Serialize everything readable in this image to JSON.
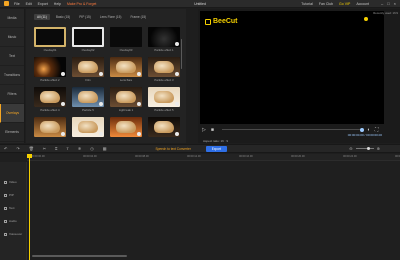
{
  "window": {
    "title": "Untitled",
    "menu": [
      "File",
      "Edit",
      "Export",
      "Help",
      "Make Pro & Forget"
    ],
    "menu_accent": "Make Pro & Forget",
    "right_menu": [
      "Tutorial",
      "Fan Club",
      "Go VIP",
      "Account"
    ]
  },
  "sidebar": {
    "items": [
      "Media",
      "Music",
      "Text",
      "Transitions",
      "Filters",
      "Overlays",
      "Elements"
    ],
    "active": "Overlays"
  },
  "media": {
    "tabs": [
      "All (11)",
      "Basic (15)",
      "PIP (15)",
      "Lens Flare (15)",
      "Frame (15)"
    ],
    "active_tab": "All (11)",
    "items": [
      {
        "caption": "Overlay01",
        "style": "frame-gold"
      },
      {
        "caption": "Overlay02",
        "style": "frame-rect"
      },
      {
        "caption": "Overlay03",
        "style": "frame-corners"
      },
      {
        "caption": "Particle effect 1",
        "style": "dark"
      },
      {
        "caption": "Particle effect 2",
        "style": "flare"
      },
      {
        "caption": "Film",
        "style": "cat"
      },
      {
        "caption": "Lens flare",
        "style": "cat-warm"
      },
      {
        "caption": "Particle effect 3",
        "style": "cat"
      },
      {
        "caption": "Particle effect 4",
        "style": "cat-dark"
      },
      {
        "caption": "Particle 5",
        "style": "cat-blue"
      },
      {
        "caption": "Light leak 1",
        "style": "cat"
      },
      {
        "caption": "Particle effect 5",
        "style": "cat-bright"
      },
      {
        "caption": "",
        "style": "cat-warm"
      },
      {
        "caption": "",
        "style": "cat-bright"
      },
      {
        "caption": "",
        "style": "cat-orange"
      },
      {
        "caption": "",
        "style": "cat-dark"
      }
    ]
  },
  "preview": {
    "watermark": "BeeCut",
    "recent": "Recently used: 16:9",
    "time": "00:00:00.00 / 00:00:00.00",
    "aspect_ratio": "Aspect ratio: 16 : 9"
  },
  "toolbar": {
    "speech": "Speech to text Converter",
    "export": "Export"
  },
  "timeline": {
    "ruler": [
      "00:00:00.00",
      "00:00:04.00",
      "00:00:08.00",
      "00:00:12.00",
      "00:00:16.00",
      "00:00:20.00",
      "00:00:24.00",
      "00:00:28.00"
    ],
    "tracks": [
      "Video",
      "PIP",
      "Text",
      "Audio",
      "Voiceover"
    ]
  },
  "colors": {
    "accent": "#f5a623",
    "export": "#2f6fe6",
    "playhead": "#f5d000"
  }
}
